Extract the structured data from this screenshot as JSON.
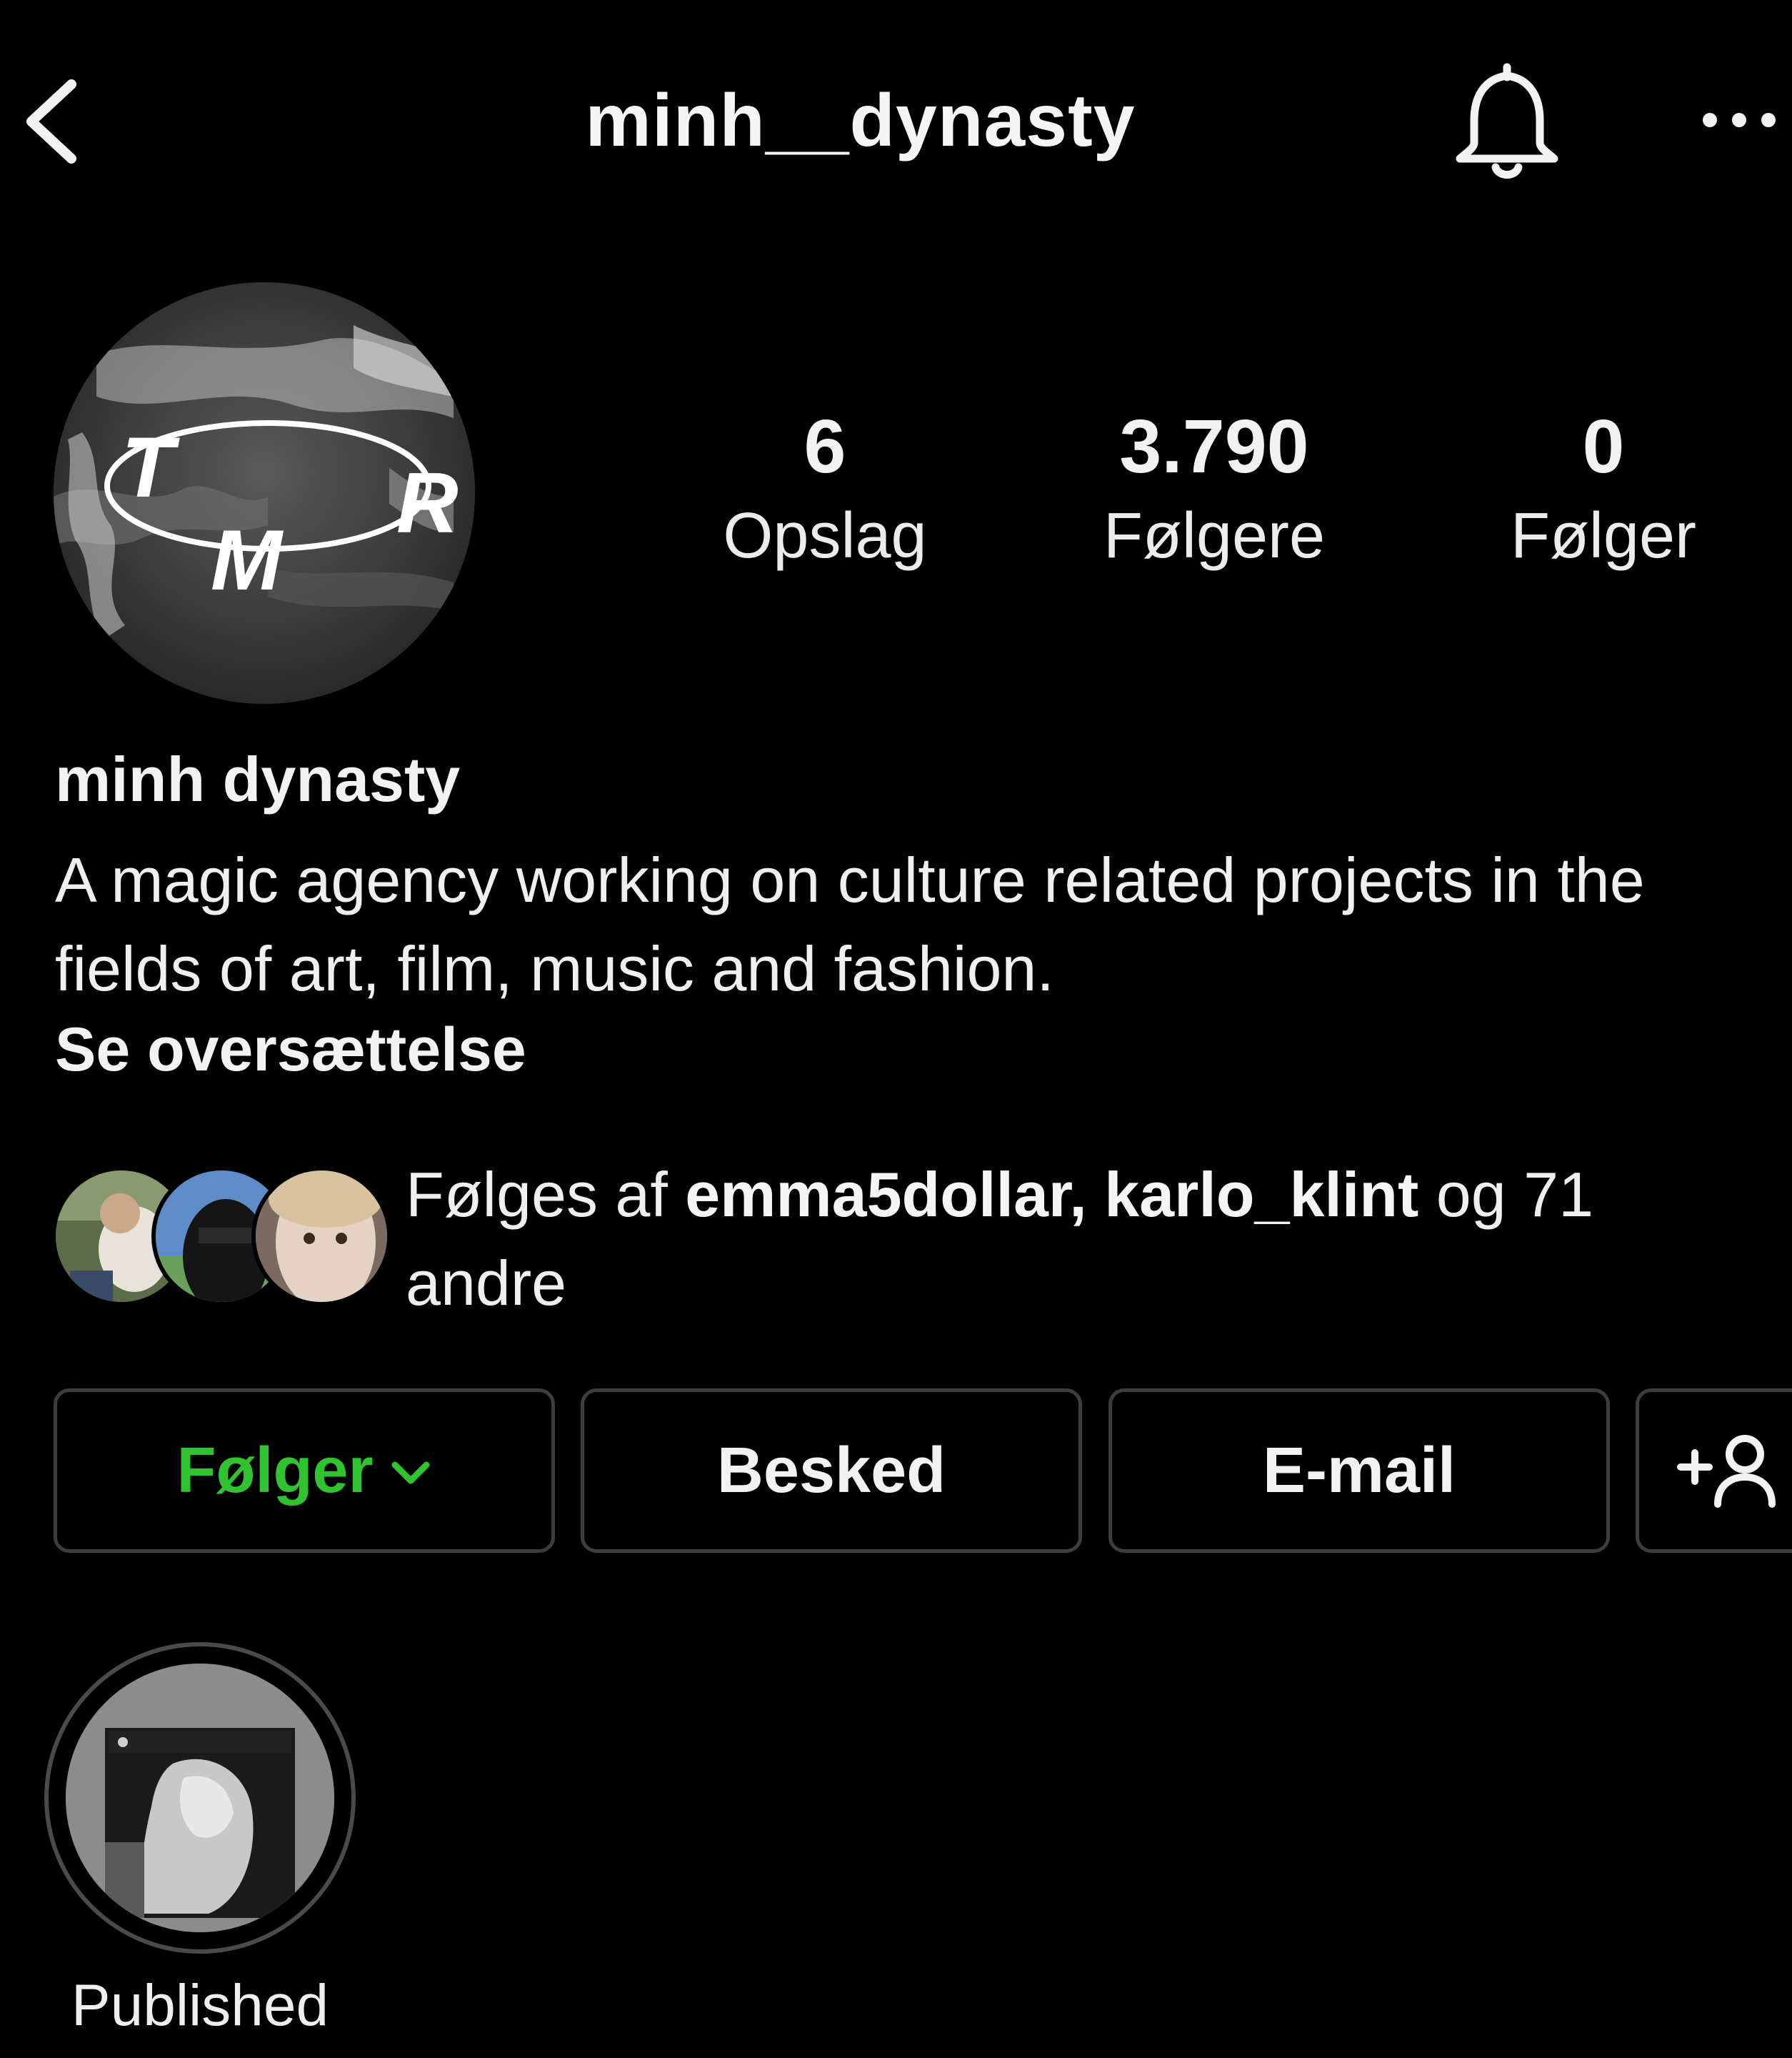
{
  "header": {
    "username": "minh__dynasty"
  },
  "profile": {
    "display_name": "minh dynasty",
    "bio": "A magic agency working on culture related projects in the fields of art, film, music and fashion.",
    "translate_label": "Se oversættelse",
    "logo_letters": [
      "T",
      "M",
      "R"
    ]
  },
  "stats": {
    "posts": {
      "value": "6",
      "label": "Opslag"
    },
    "followers": {
      "value": "3.790",
      "label": "Følgere"
    },
    "following": {
      "value": "0",
      "label": "Følger"
    }
  },
  "followed_by": {
    "prefix": "Følges af ",
    "names": "emma5dollar, karlo_klint",
    "suffix": " og 71 andre"
  },
  "buttons": {
    "follow": "Følger",
    "message": "Besked",
    "email": "E-mail"
  },
  "highlights": [
    {
      "label": "Published"
    }
  ],
  "colors": {
    "background": "#000000",
    "following_green": "#2fc42f",
    "button_border": "#3d3d3d"
  }
}
